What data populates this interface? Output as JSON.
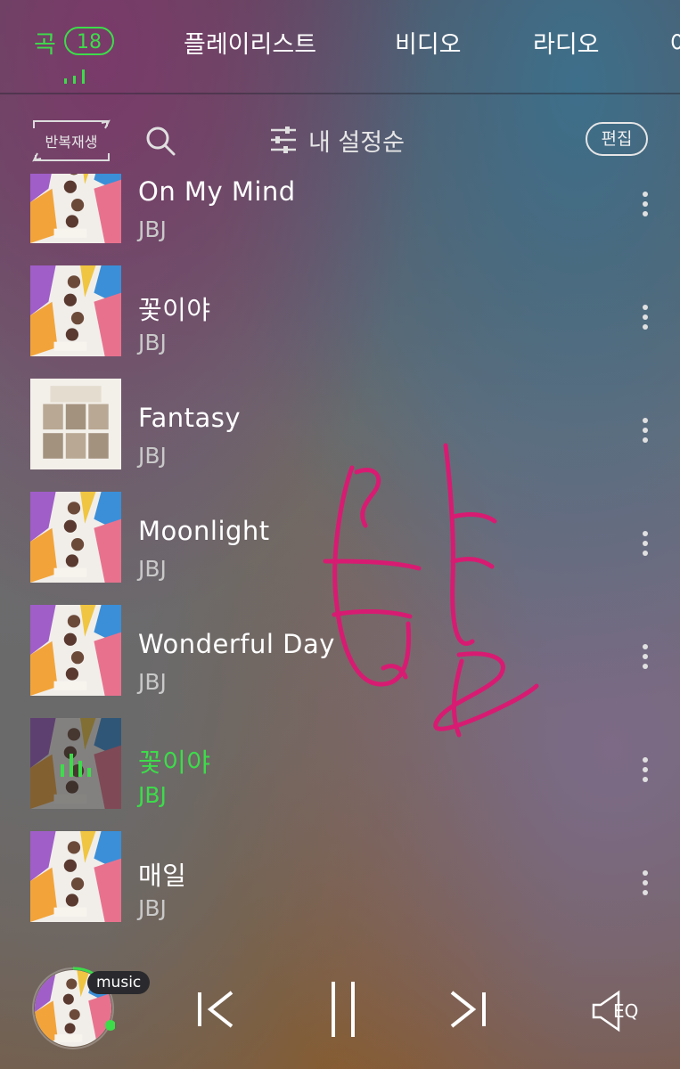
{
  "tabs": [
    {
      "label": "곡",
      "active": true
    },
    {
      "label": "플레이리스트",
      "active": false
    },
    {
      "label": "비디오",
      "active": false
    },
    {
      "label": "라디오",
      "active": false
    },
    {
      "label": "아",
      "active": false
    }
  ],
  "song_count": "18",
  "toolbar": {
    "repeat_label": "반복재생",
    "sort_label": "내 설정순",
    "edit_label": "편집"
  },
  "songs": [
    {
      "title": "On My Mind",
      "artist": "JBJ",
      "cover": "true-colors",
      "playing": false
    },
    {
      "title": "꽃이야",
      "artist": "JBJ",
      "cover": "true-colors",
      "playing": false
    },
    {
      "title": "Fantasy",
      "artist": "JBJ",
      "cover": "fantasy",
      "playing": false
    },
    {
      "title": "Moonlight",
      "artist": "JBJ",
      "cover": "true-colors",
      "playing": false
    },
    {
      "title": "Wonderful Day",
      "artist": "JBJ",
      "cover": "true-colors",
      "playing": false
    },
    {
      "title": "꽃이야",
      "artist": "JBJ",
      "cover": "true-colors",
      "playing": true
    },
    {
      "title": "매일",
      "artist": "JBJ",
      "cover": "true-colors",
      "playing": false
    }
  ],
  "player": {
    "source_badge": "music",
    "eq_label": "EQ",
    "state": "playing"
  },
  "colors": {
    "accent": "#3ddc4a",
    "handwriting": "#d81b72"
  },
  "icons": [
    "tab-eq-icon",
    "repeat-icon",
    "search-icon",
    "sliders-icon",
    "more-vertical-icon",
    "playing-bars-icon",
    "previous-icon",
    "pause-icon",
    "next-icon",
    "speaker-eq-icon"
  ]
}
